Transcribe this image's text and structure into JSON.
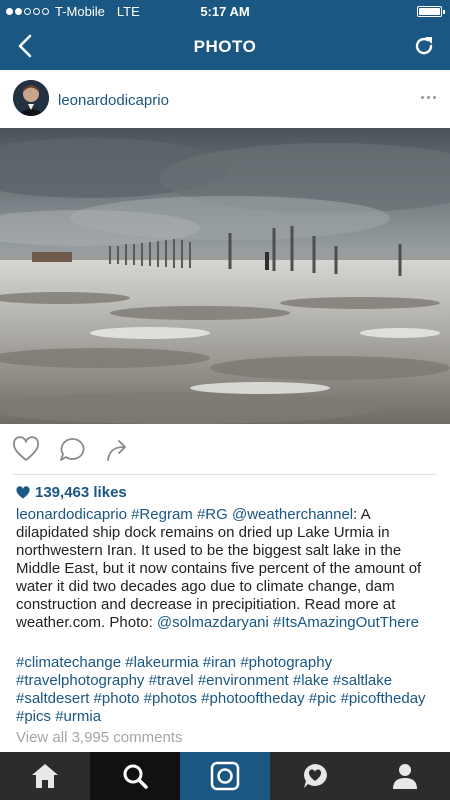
{
  "status_bar": {
    "carrier": "T-Mobile",
    "network": "LTE",
    "time": "5:17 AM"
  },
  "nav": {
    "title": "PHOTO"
  },
  "post": {
    "username": "leonardodicaprio",
    "likes": "139,463 likes",
    "caption": [
      {
        "t": "u",
        "v": "leonardodicaprio"
      },
      {
        "t": "x",
        "v": " "
      },
      {
        "t": "tag",
        "v": "#Regram"
      },
      {
        "t": "x",
        "v": " "
      },
      {
        "t": "tag",
        "v": "#RG"
      },
      {
        "t": "x",
        "v": " "
      },
      {
        "t": "tag",
        "v": "@weatherchannel"
      },
      {
        "t": "x",
        "v": ": A dilapidated ship dock remains on dried up Lake Urmia in northwestern Iran. It used to be the biggest salt lake in the Middle East, but it now contains five percent of the amount of water it did two decades ago due to climate change, dam construction and decrease in precipitiation. Read more at weather.com. Photo: "
      },
      {
        "t": "tag",
        "v": "@solmazdaryani"
      },
      {
        "t": "x",
        "v": " "
      },
      {
        "t": "tag",
        "v": "#ItsAmazingOutThere"
      }
    ],
    "hashtags": [
      "#climatechange",
      "#lakeurmia",
      "#iran",
      "#photography",
      "#travelphotography",
      "#travel",
      "#environment",
      "#lake",
      "#saltlake",
      "#saltdesert",
      "#photo",
      "#photos",
      "#photooftheday",
      "#pic",
      "#picoftheday",
      "#pics",
      "#urmia"
    ],
    "view_comments": "View all 3,995 comments"
  },
  "tab_bar": {
    "tabs": [
      {
        "name": "home-icon"
      },
      {
        "name": "search-icon"
      },
      {
        "name": "camera-icon"
      },
      {
        "name": "activity-heart-icon"
      },
      {
        "name": "profile-icon"
      }
    ]
  },
  "colors": {
    "brand": "#1a5783",
    "tab_bar": "#2c2c2c",
    "link": "#1a5783",
    "muted": "#a5a5a5"
  }
}
